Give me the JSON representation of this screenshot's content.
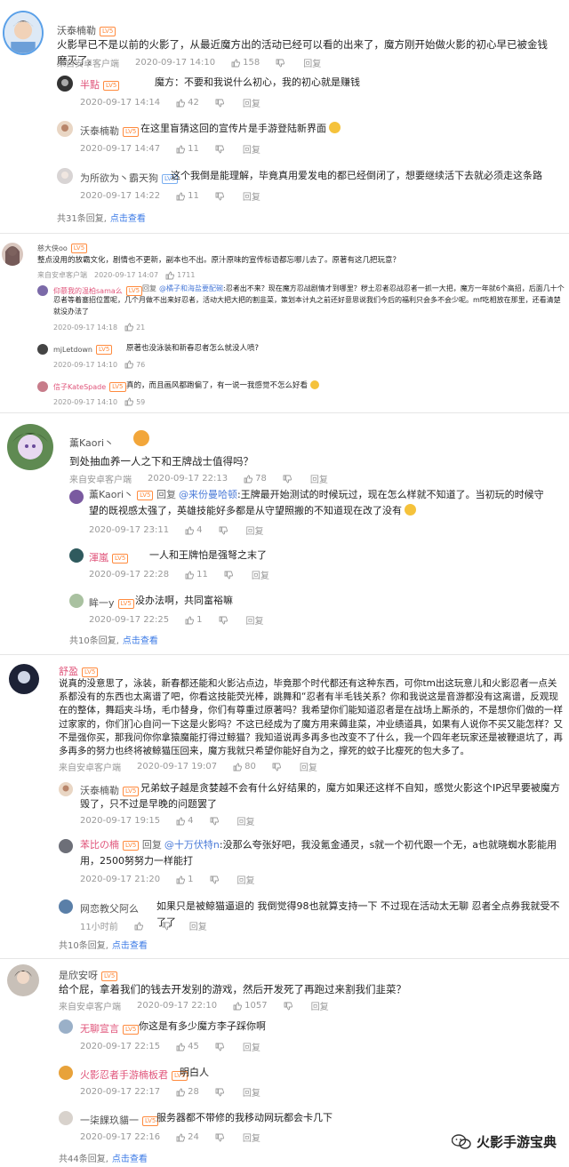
{
  "labels": {
    "reply": "回复",
    "view": "点击查看",
    "reply_to": "回复"
  },
  "colors": {
    "link": "#3b7ae6",
    "badge_orange": "#ff8a3d",
    "badge_blue": "#5d95e6"
  },
  "icons": {
    "like": "thumbs-up-icon",
    "dislike": "thumbs-down-icon",
    "watermark": "wechat-logo-icon"
  },
  "threads": [
    {
      "user": "沃泰楠勒",
      "level": "LV5",
      "text": "火影早已不是以前的火影了，从最近魔方出的活动已经可以看的出来了，魔方刚开始做火影的初心早已被金钱磨灭了。",
      "source": "来自安卓客户端",
      "time": "2020-09-17 14:10",
      "likes": "158",
      "replies": [
        {
          "user": "半點",
          "level": "LV5",
          "text": "魔方：不要和我说什么初心，我的初心就是赚钱",
          "time": "2020-09-17 14:14",
          "likes": "42"
        },
        {
          "user": "沃泰楠勒",
          "level": "LV5",
          "text": "在这里盲猜这回的宣传片是手游登陆新界面",
          "time": "2020-09-17 14:47",
          "likes": "11"
        },
        {
          "user": "为所欲为丶霸天狗",
          "level": "LV5",
          "text": "这个我倒是能理解，毕竟真用爱发电的都已经倒闭了，想要继续活下去就必须走这条路",
          "time": "2020-09-17 14:22",
          "likes": "11"
        }
      ],
      "more_count": "共31条回复,"
    },
    {
      "user": "慈大侠oo",
      "level": "LV5",
      "text": "整点没用的放霸文化，剧情也不更新，副本也不出。原汁原味的宣传标语都忘哪儿去了。原著有这几把玩意？",
      "source": "来自安卓客户端",
      "time": "2020-09-17 14:07",
      "likes": "1711",
      "replies": [
        {
          "user": "仰慕我的温柏sama么",
          "level": "LV5",
          "reply_to": "@橘子和海盐要配碗",
          "text": ":忍者出不来？现在魔方忍战剧情才到哪里？秽土忍者忍战忍者一抓一大把，魔方一年就6个高招，后面几十个忍者等着塞招位置呢，几个月做不出来好忍者，活动大把大把的割韭菜，策划本计丸之前还好意思说我们今后的福利只会多不会少呢。mf吃相放在那里，还看清楚就没办法了",
          "time": "2020-09-17 14:18",
          "likes": "21"
        },
        {
          "user": "mjLetdown",
          "level": "LV5",
          "text": "原著也没泳装和新春忍者怎么就没人喷?",
          "time": "2020-09-17 14:10",
          "likes": "76"
        },
        {
          "user": "信子KateSpade",
          "level": "LV5",
          "text": "真的，而且画风都跑偏了，有一说一我感觉不怎么好看",
          "time": "2020-09-17 14:10",
          "likes": "59"
        }
      ]
    },
    {
      "user": "薰Kaori丶",
      "level": "",
      "text": "到处抽血养一人之下和王牌战士值得吗？",
      "source": "来自安卓客户端",
      "time": "2020-09-17 22:13",
      "likes": "78",
      "replies": [
        {
          "user": "薰Kaori丶",
          "level": "LV5",
          "reply_to": "@来份曼哈顿",
          "text": ":王牌最开始测试的时候玩过，现在怎么样就不知道了。当初玩的时候守望的既视感太强了，英雄技能好多都是从守望照搬的不知道现在改了没有",
          "time": "2020-09-17 23:11",
          "likes": "4"
        },
        {
          "user": "渾嵐",
          "level": "LV5",
          "text": "一人和王牌怕是强弩之末了",
          "time": "2020-09-17 22:28",
          "likes": "11"
        },
        {
          "user": "眸一y",
          "level": "LV5",
          "text": "没办法啊，共同富裕嘛",
          "time": "2020-09-17 22:25",
          "likes": "1"
        }
      ],
      "more_count": "共10条回复,"
    },
    {
      "user": "舒盈",
      "level": "LV5",
      "text": "说真的没意思了，泳装，新春都还能和火影沾点边，毕竟那个时代都还有这种东西，可你tm出这玩意儿和火影忍者一点关系都没有的东西也太离谱了吧，你看这技能荧光棒，跳舞和“忍者有半毛钱关系？你和我说这是音游都没有这离谱，反观现在的整体，舞蹈夹斗场，毛巾替身，你们有尊重过原著吗？我希望你们能知道忍者是在战场上厮杀的，不是想你们做的一样过家家的，你们扪心自问一下这是火影吗？不这已经成为了魔方用来薅韭菜，冲业绩道具，如果有人说你不买又能怎样？又不是强你买，那我问你你拿猿魔能打得过鲸猫？我知道说再多再多也改变不了什么，我一个四年老玩家还是被鞭退坑了，再多再多的努力也终将被鲸猫压回来，魔方我就只希望你能好自为之，撑死的蚊子比瘦死的包大多了。",
      "source": "来自安卓客户端",
      "time": "2020-09-17 19:07",
      "likes": "80",
      "replies": [
        {
          "user": "沃泰楠勒",
          "level": "LV5",
          "text": "兄弟蚊子越是贪婪越不会有什么好结果的，魔方如果还这样不自知，感觉火影这个IP迟早要被魔方毁了，只不过是早晚的问题罢了",
          "time": "2020-09-17 19:15",
          "likes": "4"
        },
        {
          "user": "苯比の楠",
          "level": "LV5",
          "reply_to": "@十万伏特n",
          "text": ":没那么夸张好吧，我没氪金通灵，s就一个初代跟一个无，a也就晓蜘水影能用用，2500努努力一样能打",
          "time": "2020-09-17 21:20",
          "likes": "1"
        },
        {
          "user": "网恋教父阿么",
          "level": "LV5",
          "text": "如果只是被鲸猫逼退的 我倒觉得98也就算支持一下 不过现在活动太无聊 忍者全点券我就受不了了",
          "time": "11小时前",
          "likes": "0"
        }
      ],
      "more_count": "共10条回复,"
    },
    {
      "user": "是欣安呀",
      "level": "LV5",
      "text": "给个屁，拿着我们的钱去开发别的游戏，然后开发死了再跑过来割我们韭菜？",
      "source": "来自安卓客户端",
      "time": "2020-09-17 22:10",
      "likes": "1057",
      "replies": [
        {
          "user": "无聊宣言",
          "level": "LV5",
          "text": "你这是有多少魔方李子踩你啊",
          "time": "2020-09-17 22:15",
          "likes": "45"
        },
        {
          "user": "火影忍者手游楠板君",
          "level": "LV5",
          "text": "明白人",
          "time": "2020-09-17 22:17",
          "likes": "28"
        },
        {
          "user": "一柒餜玖貓一",
          "level": "LV5",
          "text": "服务器都不带修的我移动网玩都会卡几下",
          "time": "2020-09-17 22:16",
          "likes": "24"
        }
      ],
      "more_count": "共44条回复,"
    }
  ],
  "watermark": "火影手游宝典"
}
